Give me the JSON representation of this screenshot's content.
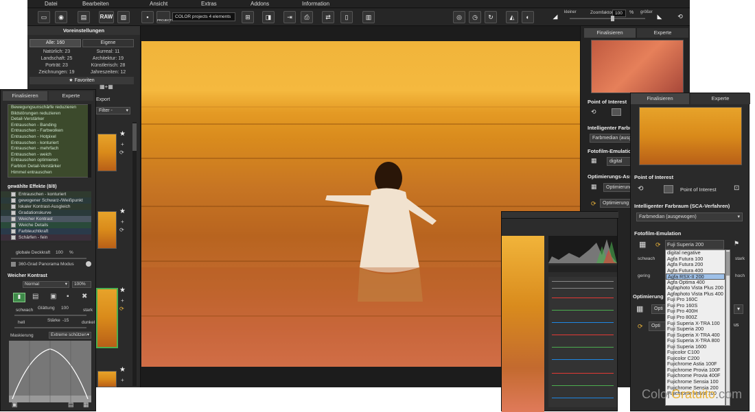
{
  "menu": [
    "Datei",
    "Bearbeiten",
    "Ansicht",
    "Extras",
    "Addons",
    "Information"
  ],
  "toolbar": {
    "raw_label": "RAW",
    "projects_label": "PROJECTS",
    "project_select": "COLOR projects 4 elements",
    "zoom_smaller": "kleiner",
    "zoom_label": "Zoomfaktor",
    "zoom_value": "100",
    "zoom_unit": "%",
    "zoom_larger": "größer"
  },
  "presets": {
    "title": "Voreinstellungen",
    "tab_all": "Alle: 160",
    "tab_own": "Eigene",
    "rows": [
      [
        "Natürlich: 23",
        "Surreal: 11"
      ],
      [
        "Landschaft: 25",
        "Architektur: 19"
      ],
      [
        "Porträt: 23",
        "Künstlerisch: 28"
      ],
      [
        "Zeichnungen: 19",
        "Jahreszeiten: 12"
      ]
    ],
    "favorites": "Favoriten",
    "export_tab": "Export",
    "filter_select": "Filter -"
  },
  "right_panel": {
    "tab_finalize": "Finalisieren",
    "tab_expert": "Experte",
    "poi": "Point of Interest",
    "intelligent": "Intelligenter Farbr",
    "farbmedian": "Farbmedian (ausge",
    "fotofilm": "Fotofilm-Emulation",
    "digital": "digital",
    "optimierung": "Optimierungs-Assi",
    "optim_btn": "Optimierung",
    "optim_btn2": "Optimierung",
    "na": "Na",
    "ungs": "ungs"
  },
  "left_window": {
    "tab_finalize": "Finalisieren",
    "tab_expert": "Experte",
    "effects": [
      "Bewegungsunschärfe reduzieren",
      "Bildstörungen reduzieren",
      "Detail-Verstärker",
      "Entrauschen - Banding",
      "Entrauschen - Farbwolken",
      "Entrauschen - Hotpixel",
      "Entrauschen - konturiert",
      "Entrauschen - mehrfach",
      "Entrauschen - weich",
      "Entrauschen optimieren",
      "Farbton Detail-Verstärker",
      "Himmel entrauschen"
    ],
    "selected_title": "gewählte Effekte (8/8)",
    "selected": [
      "Entrauschen - konturiert",
      "gewogener Schwarz-/Weißpunkt",
      "lokaler Kontrast-Ausgleich",
      "Gradationskurve",
      "Weicher Kontrast",
      "Weiche Details",
      "Farbleuchtkraft",
      "Schärfen - fein"
    ],
    "global_label": "globale Deckkraft",
    "global_value": "100",
    "global_unit": "%",
    "panorama": "360-Grad Panorama Modus",
    "soft_title": "Weicher Kontrast",
    "soft_mode": "Normal",
    "soft_pct": "100%",
    "schwach": "schwach",
    "glaettung_label": "Glättung",
    "glaettung_value": "100",
    "stark": "stark",
    "hell": "hell",
    "staerke_label": "Stärke",
    "staerke_value": "-15",
    "dunkel": "dunkel",
    "masking": "Maskierung",
    "masking_select": "Extreme schützen"
  },
  "right_window": {
    "tab_finalize": "Finalisieren",
    "tab_expert": "Experte",
    "poi": "Point of Interest",
    "poi_btn": "Point of Interest",
    "intelligent": "Intelligenter Farbraum (SCA-Verfahren)",
    "farbmedian": "Farbmedian (ausgewogen)",
    "fotofilm": "Fotofilm-Emulation",
    "film_selected": "Fuji Superia 200",
    "schwach": "schwach",
    "stark": "stark",
    "gering": "gering",
    "hoch": "hoch",
    "optimierung": "Optimierung",
    "opti_btn": "Opti",
    "opti_btn2": "Opti",
    "us": "us",
    "films": [
      "digital negative",
      "Agfa Futura 100",
      "Agfa Futura 200",
      "Agfa Futura 400",
      "Agfa RSX-II 200",
      "Agfa Optima 400",
      "Agfaphoto Vista Plus 200",
      "Agfaphoto Vista Plus 400",
      "Fuji Pro 160C",
      "Fuji Pro 160S",
      "Fuji Pro 400H",
      "Fuji Pro 800Z",
      "Fuji Superia X-TRA 100",
      "Fuji Superia 200",
      "Fuji Superia X-TRA 400",
      "Fuji Superia X-TRA 800",
      "Fuji Superia 1600",
      "Fujicolor C100",
      "Fujicolor C200",
      "Fujichrome Astia 100F",
      "Fujichrome Provia 100F",
      "Fujichrome Provia 400F",
      "Fujichrome Sensia 100",
      "Fujichrome Sensia 200",
      "Fujichrome Velvia 100"
    ],
    "film_highlighted_index": 4
  },
  "watermark": {
    "part1": "Color",
    "part2": "Gratuito",
    "part3": ".com"
  }
}
